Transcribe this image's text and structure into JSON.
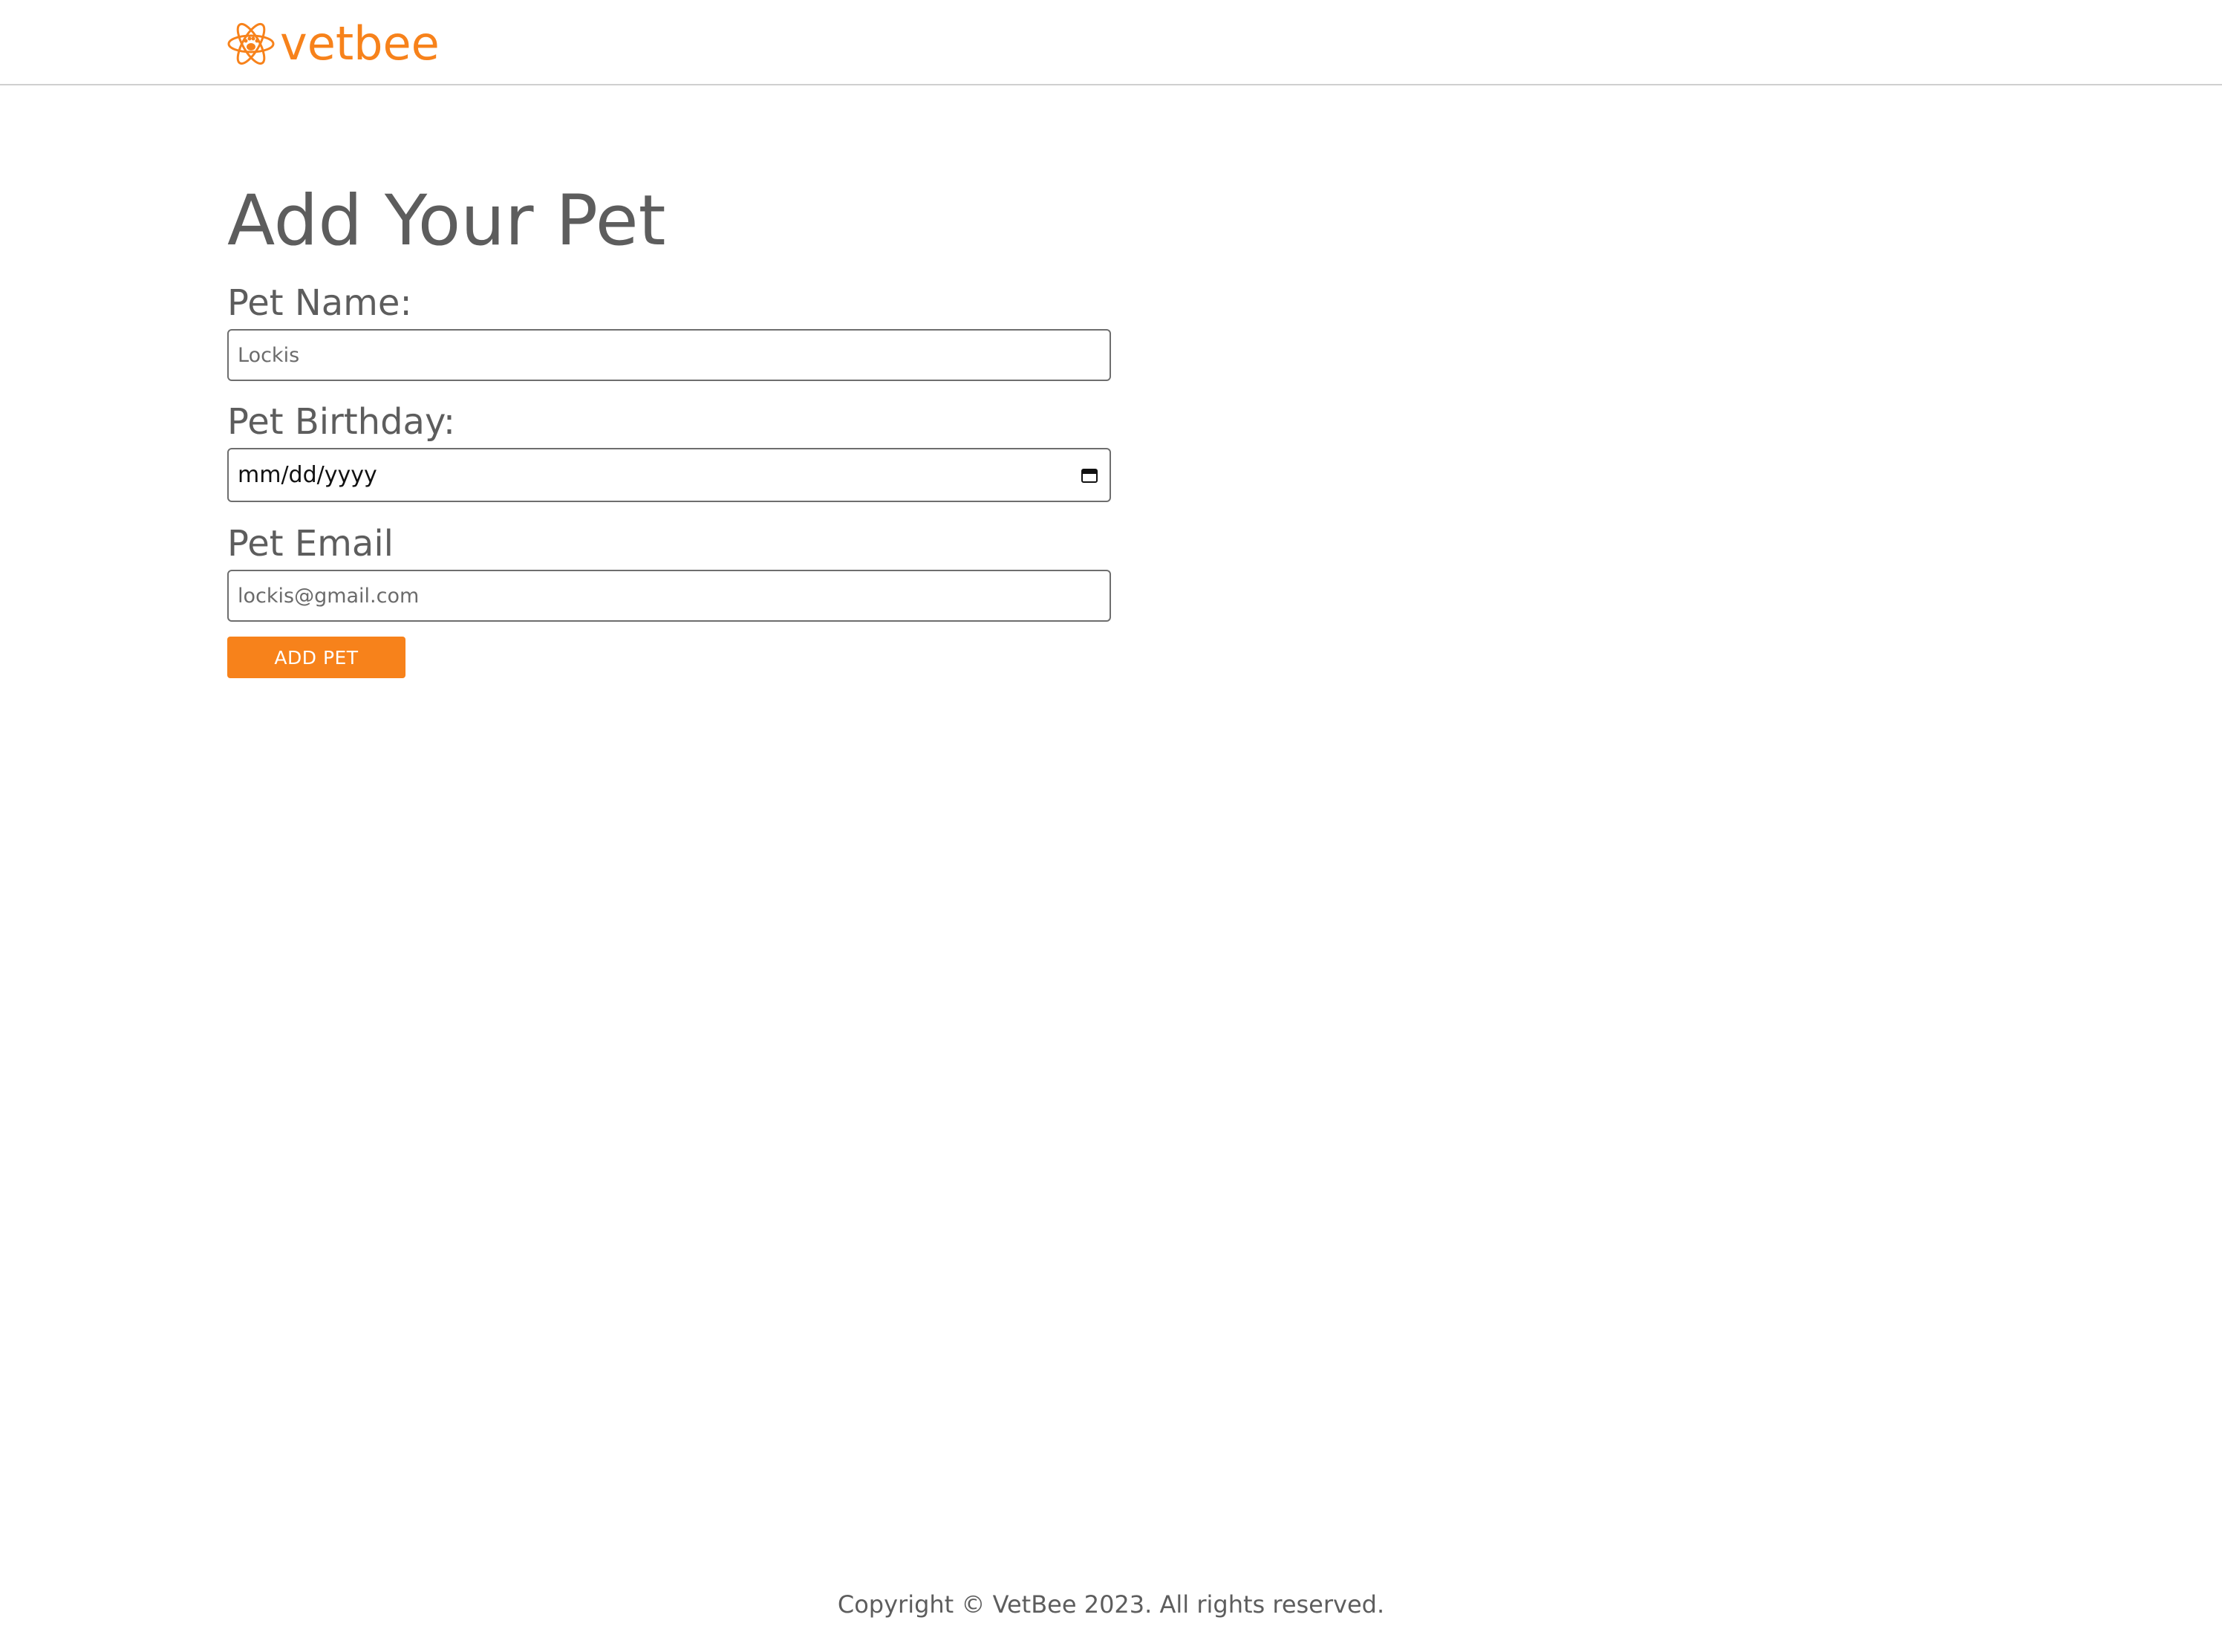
{
  "header": {
    "logo_text": "vetbee",
    "logo_icon": "atom-paw-icon",
    "brand_color": "#f7821b"
  },
  "form": {
    "title": "Add Your Pet",
    "name_label": "Pet Name:",
    "name_value": "Lockis",
    "birthday_label": "Pet Birthday:",
    "birthday_value": "mm/dd/yyyy",
    "birthday_icon": "calendar-icon",
    "email_label": "Pet Email",
    "email_value": "lockis@gmail.com",
    "submit_label": "ADD PET"
  },
  "footer": {
    "copyright": "Copyright © VetBee 2023. All rights reserved."
  }
}
